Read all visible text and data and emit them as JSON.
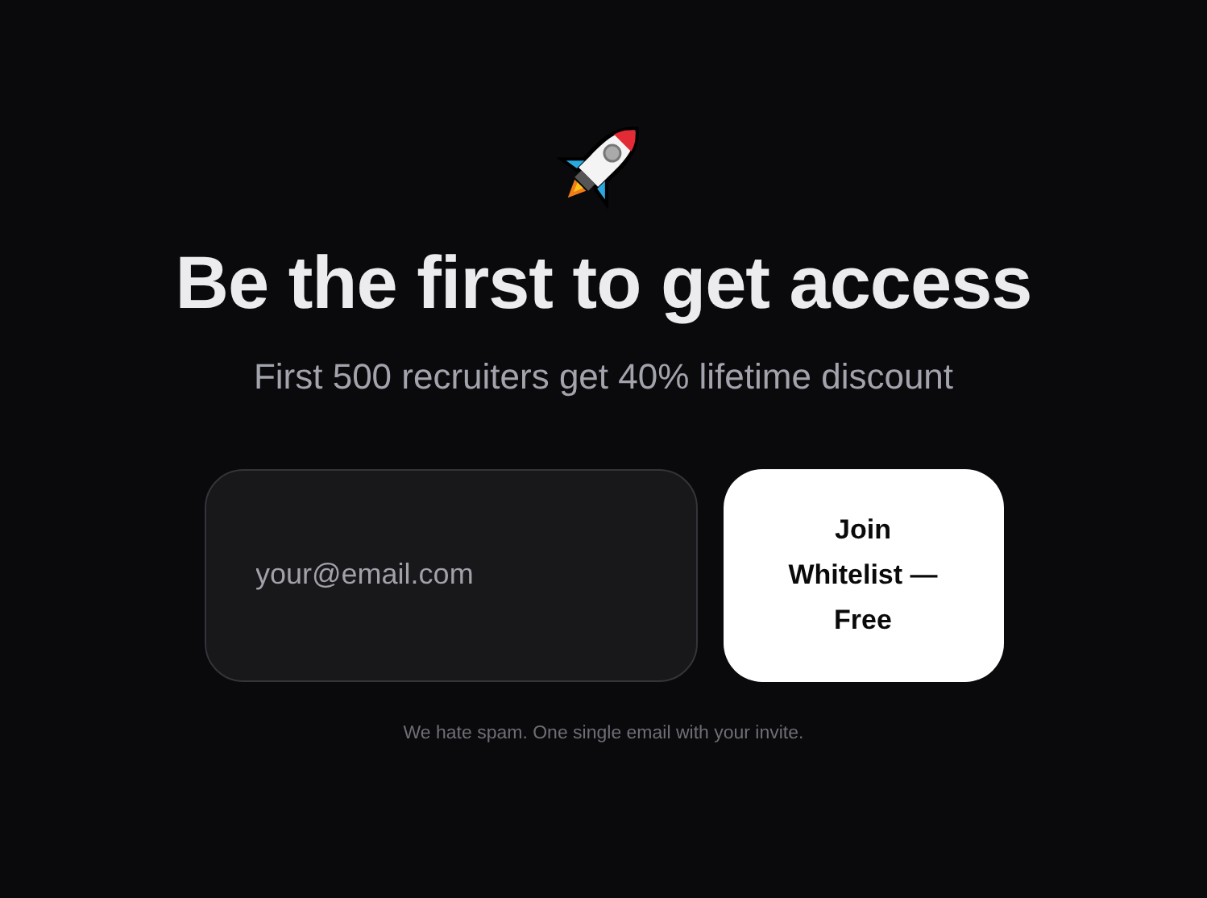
{
  "heading": "Be the first to get access",
  "subheading": "First 500 recruiters get 40% lifetime discount",
  "email_field": {
    "placeholder": "your@email.com"
  },
  "submit_button": {
    "label": "Join Whitelist — Free"
  },
  "note": "We hate spam. One single email with your invite."
}
